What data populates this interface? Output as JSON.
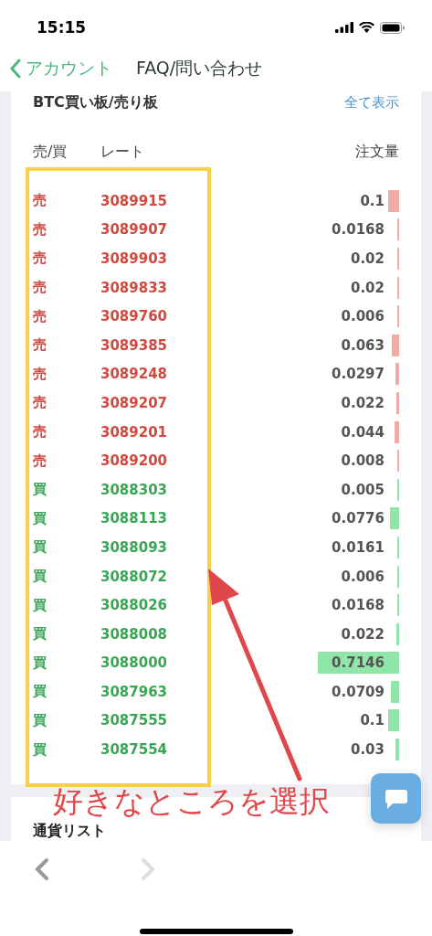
{
  "status_bar": {
    "time": "15:15"
  },
  "nav": {
    "back_label": "アカウント",
    "title": "FAQ/問い合わせ"
  },
  "order_book": {
    "title": "BTC買い板/売り板",
    "show_all": "全て表示",
    "columns": [
      "売/買",
      "レート",
      "注文量"
    ],
    "rows": [
      {
        "kind": "sell",
        "side": "売",
        "rate": "3089915",
        "amount": "0.1"
      },
      {
        "kind": "sell",
        "side": "売",
        "rate": "3089907",
        "amount": "0.0168"
      },
      {
        "kind": "sell",
        "side": "売",
        "rate": "3089903",
        "amount": "0.02"
      },
      {
        "kind": "sell",
        "side": "売",
        "rate": "3089833",
        "amount": "0.02"
      },
      {
        "kind": "sell",
        "side": "売",
        "rate": "3089760",
        "amount": "0.006"
      },
      {
        "kind": "sell",
        "side": "売",
        "rate": "3089385",
        "amount": "0.063"
      },
      {
        "kind": "sell",
        "side": "売",
        "rate": "3089248",
        "amount": "0.0297"
      },
      {
        "kind": "sell",
        "side": "売",
        "rate": "3089207",
        "amount": "0.022"
      },
      {
        "kind": "sell",
        "side": "売",
        "rate": "3089201",
        "amount": "0.044"
      },
      {
        "kind": "sell",
        "side": "売",
        "rate": "3089200",
        "amount": "0.008"
      },
      {
        "kind": "buy",
        "side": "買",
        "rate": "3088303",
        "amount": "0.005"
      },
      {
        "kind": "buy",
        "side": "買",
        "rate": "3088113",
        "amount": "0.0776"
      },
      {
        "kind": "buy",
        "side": "買",
        "rate": "3088093",
        "amount": "0.0161"
      },
      {
        "kind": "buy",
        "side": "買",
        "rate": "3088072",
        "amount": "0.006"
      },
      {
        "kind": "buy",
        "side": "買",
        "rate": "3088026",
        "amount": "0.0168"
      },
      {
        "kind": "buy",
        "side": "買",
        "rate": "3088008",
        "amount": "0.022"
      },
      {
        "kind": "buy",
        "side": "買",
        "rate": "3088000",
        "amount": "0.7146"
      },
      {
        "kind": "buy",
        "side": "買",
        "rate": "3087963",
        "amount": "0.0709"
      },
      {
        "kind": "buy",
        "side": "買",
        "rate": "3087555",
        "amount": "0.1"
      },
      {
        "kind": "buy",
        "side": "買",
        "rate": "3087554",
        "amount": "0.03"
      }
    ]
  },
  "currency_list": {
    "title": "通貨リスト"
  },
  "annotation": {
    "caption": "好きなところを選択"
  }
}
